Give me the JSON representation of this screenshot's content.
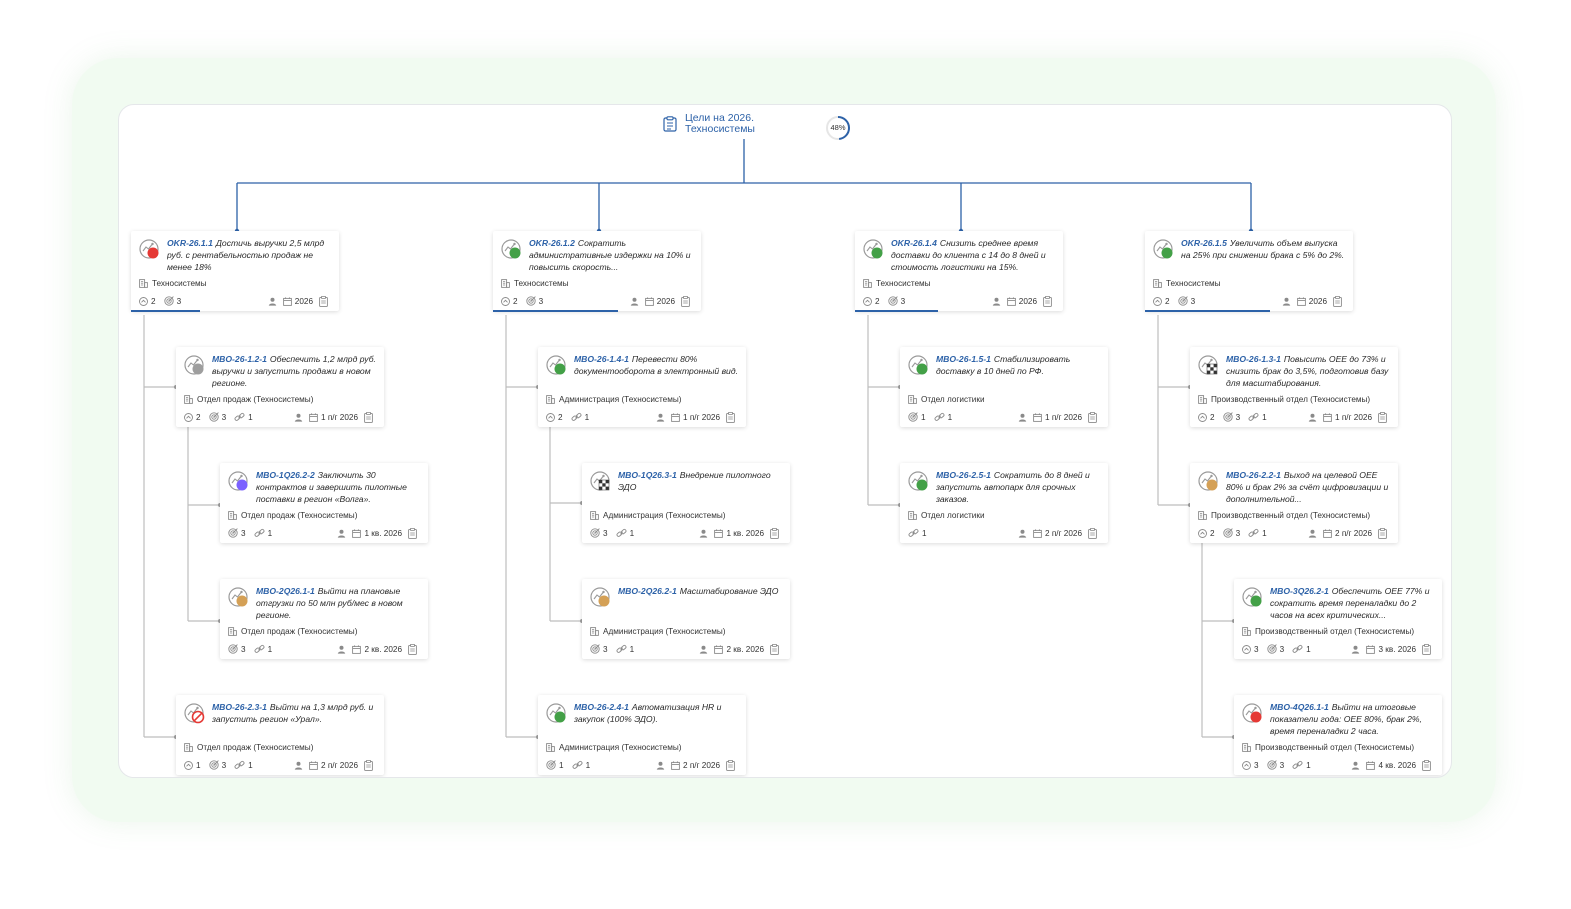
{
  "root": {
    "title": "Цели на 2026. Техносистемы",
    "progress": "48%",
    "progress_value": 0.48
  },
  "colors": {
    "link": "#2d62a8",
    "red": "#e53935",
    "green": "#43a047",
    "gray": "#9e9e9e",
    "purple": "#7b61ff",
    "amber": "#d4a056"
  },
  "cards": [
    {
      "code": "OKR-26.1.1",
      "title": "Достичь выручки 2,5 млрд руб. с рентабельностью продаж не менее 18%",
      "org": "Техносистемы",
      "status": "red",
      "c1": "2",
      "c2": "3",
      "period": "2026",
      "progress": 0.33
    },
    {
      "code": "OKR-26.1.2",
      "title": "Сократить административные издержки на 10% и повысить скорость...",
      "org": "Техносистемы",
      "status": "green",
      "c1": "2",
      "c2": "3",
      "period": "2026",
      "progress": 0.6
    },
    {
      "code": "OKR-26.1.4",
      "title": "Снизить среднее время доставки до клиента с 14 до 8 дней и стоимость логистики на 15%.",
      "org": "Техносистемы",
      "status": "green",
      "c1": "2",
      "c2": "3",
      "period": "2026",
      "progress": 0.4
    },
    {
      "code": "OKR-26.1.5",
      "title": "Увеличить объем выпуска на 25% при снижении брака с 5% до 2%.",
      "org": "Техносистемы",
      "status": "green",
      "c1": "2",
      "c2": "3",
      "period": "2026",
      "progress": 0.6
    },
    {
      "code": "MBO-26-1.2-1",
      "title": "Обеспечить 1,2 млрд руб. выручки и запустить продажи в новом регионе.",
      "org": "Отдел продаж (Техносистемы)",
      "status": "gray",
      "c1": "2",
      "c2": "3",
      "c3": "1",
      "period": "1 п/г 2026"
    },
    {
      "code": "MBO-1Q26.2-2",
      "title": "Заключить 30 контрактов и завершить пилотные поставки в регион «Волга».",
      "org": "Отдел продаж (Техносистемы)",
      "status": "purple",
      "c2": "3",
      "c3": "1",
      "period": "1 кв. 2026"
    },
    {
      "code": "MBO-2Q26.1-1",
      "title": "Выйти на плановые отгрузки по 50 млн руб/мес в новом регионе.",
      "org": "Отдел продаж (Техносистемы)",
      "status": "amber",
      "c2": "3",
      "c3": "1",
      "period": "2 кв. 2026"
    },
    {
      "code": "MBO-26-2.3-1",
      "title": "Выйти на 1,3 млрд руб. и запустить регион «Урал».",
      "org": "Отдел продаж (Техносистемы)",
      "status": "cancel",
      "c1": "1",
      "c2": "3",
      "c3": "1",
      "period": "2 п/г 2026"
    },
    {
      "code": "MBO-26-1.4-1",
      "title": "Перевести 80% документооборота в электронный вид.",
      "org": "Администрация (Техносистемы)",
      "status": "green",
      "c1": "2",
      "c3": "1",
      "period": "1 п/г 2026"
    },
    {
      "code": "MBO-1Q26.3-1",
      "title": "Внедрение пилотного ЭДО",
      "org": "Администрация (Техносистемы)",
      "status": "checker",
      "c2": "3",
      "c3": "1",
      "period": "1 кв. 2026"
    },
    {
      "code": "MBO-2Q26.2-1",
      "title": "Масштабирование ЭДО",
      "org": "Администрация (Техносистемы)",
      "status": "amber",
      "c2": "3",
      "c3": "1",
      "period": "2 кв. 2026"
    },
    {
      "code": "MBO-26-2.4-1",
      "title": "Автоматизация HR и закупок (100% ЭДО).",
      "org": "Администрация (Техносистемы)",
      "status": "green",
      "c2": "1",
      "c3": "1",
      "period": "2 п/г 2026"
    },
    {
      "code": "MBO-26-1.5-1",
      "title": "Стабилизировать доставку в 10 дней по РФ.",
      "org": "Отдел логистики",
      "status": "green",
      "c2": "1",
      "c3": "1",
      "period": "1 п/г 2026"
    },
    {
      "code": "MBO-26-2.5-1",
      "title": "Сократить до 8 дней и запустить автопарк для срочных заказов.",
      "org": "Отдел логистики",
      "status": "green",
      "c3": "1",
      "period": "2 п/г 2026"
    },
    {
      "code": "MBO-26-1.3-1",
      "title": "Повысить OEE до 73% и снизить брак до 3,5%, подготовив базу для масштабирования.",
      "org": "Производственный отдел (Техносистемы)",
      "status": "checker",
      "c1": "2",
      "c2": "3",
      "c3": "1",
      "period": "1 п/г 2026"
    },
    {
      "code": "MBO-26-2.2-1",
      "title": "Выход на целевой OEE 80% и брак 2% за счёт цифровизации и дополнительной...",
      "org": "Производственный отдел (Техносистемы)",
      "status": "amber",
      "c1": "2",
      "c2": "3",
      "c3": "1",
      "period": "2 п/г 2026"
    },
    {
      "code": "MBO-3Q26.2-1",
      "title": "Обеспечить OEE 77% и сократить время переналадки до 2 часов на всех критических...",
      "org": "Производственный отдел (Техносистемы)",
      "status": "green",
      "c1": "3",
      "c2": "3",
      "c3": "1",
      "period": "3 кв. 2026"
    },
    {
      "code": "MBO-4Q26.1-1",
      "title": "Выйти на итоговые показатели года: OEE 80%, брак 2%, время переналадки 2 часа.",
      "org": "Производственный отдел (Техносистемы)",
      "status": "red",
      "c1": "3",
      "c2": "3",
      "c3": "1",
      "period": "4 кв. 2026"
    }
  ]
}
